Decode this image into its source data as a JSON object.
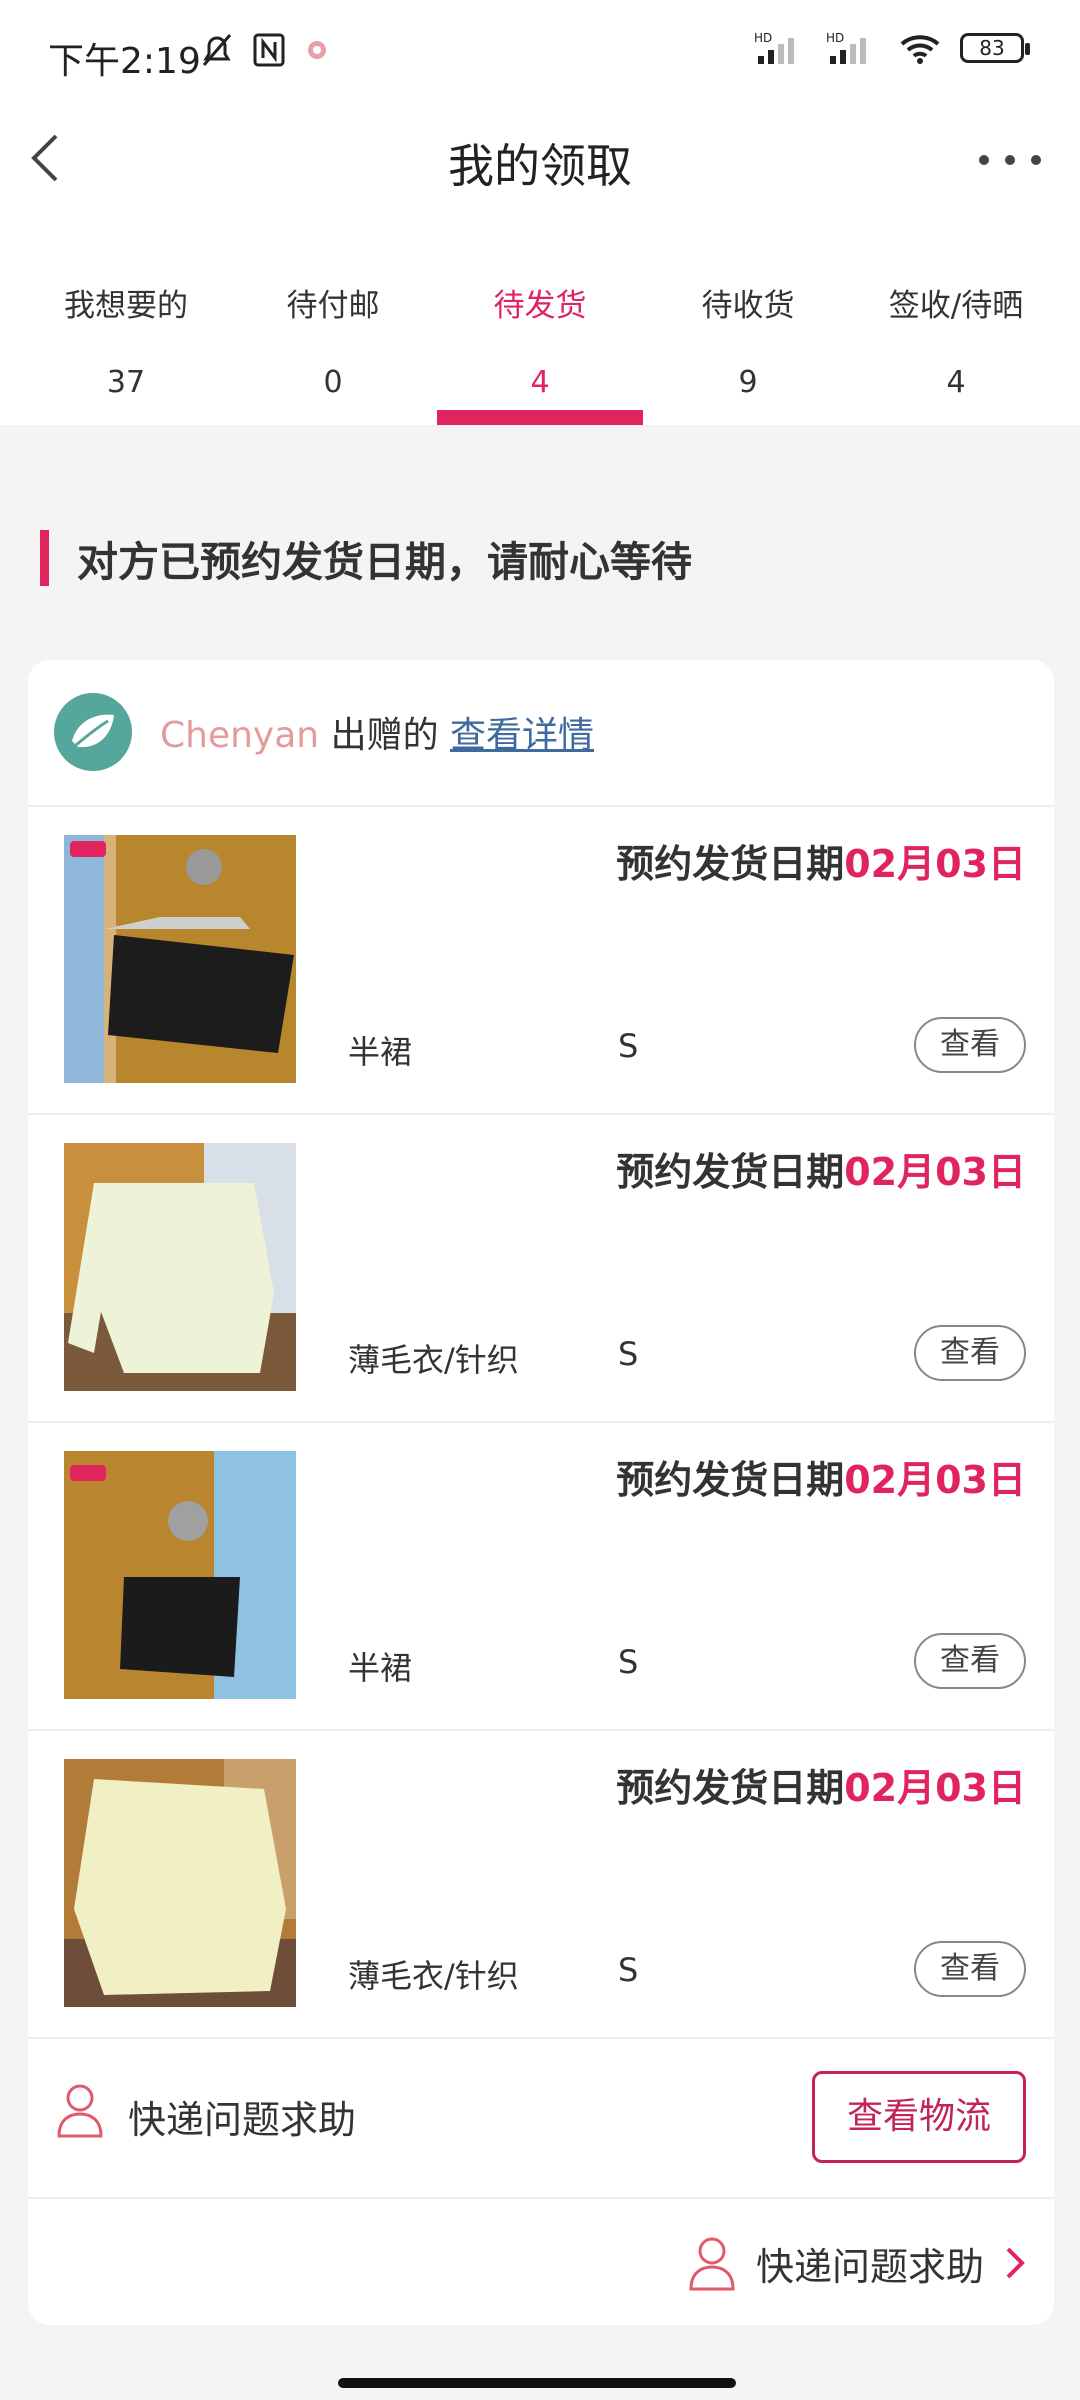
{
  "status_bar": {
    "time": "下午2:19",
    "battery": "83",
    "icons": [
      "bell-off-icon",
      "nfc-icon",
      "app-icon",
      "signal-hd-icon",
      "signal-hd-icon",
      "wifi-icon",
      "battery-icon"
    ]
  },
  "header": {
    "title": "我的领取",
    "back_icon": "chevron-left-icon",
    "more_icon": "more-dots-icon"
  },
  "tabs": [
    {
      "label": "我想要的",
      "count": "37",
      "active": false
    },
    {
      "label": "待付邮",
      "count": "0",
      "active": false
    },
    {
      "label": "待发货",
      "count": "4",
      "active": true
    },
    {
      "label": "待收货",
      "count": "9",
      "active": false
    },
    {
      "label": "签收/待晒",
      "count": "4",
      "active": false
    }
  ],
  "notice": "对方已预约发货日期，请耐心等待",
  "card": {
    "giver_name": "Chenyan",
    "giver_text": "出赠的",
    "giver_link": "查看详情",
    "items": [
      {
        "date_label": "预约发货日期",
        "date": "02月03日",
        "category": "半裙",
        "size": "S",
        "button": "查看"
      },
      {
        "date_label": "预约发货日期",
        "date": "02月03日",
        "category": "薄毛衣/针织",
        "size": "S",
        "button": "查看"
      },
      {
        "date_label": "预约发货日期",
        "date": "02月03日",
        "category": "半裙",
        "size": "S",
        "button": "查看"
      },
      {
        "date_label": "预约发货日期",
        "date": "02月03日",
        "category": "薄毛衣/针织",
        "size": "S",
        "button": "查看"
      }
    ],
    "help_text": "快递问题求助",
    "logistics_button": "查看物流",
    "bottom_help": "快递问题求助"
  },
  "colors": {
    "accent": "#e0245e",
    "link": "#3f6a9e",
    "giver_name": "#e59b9b"
  }
}
